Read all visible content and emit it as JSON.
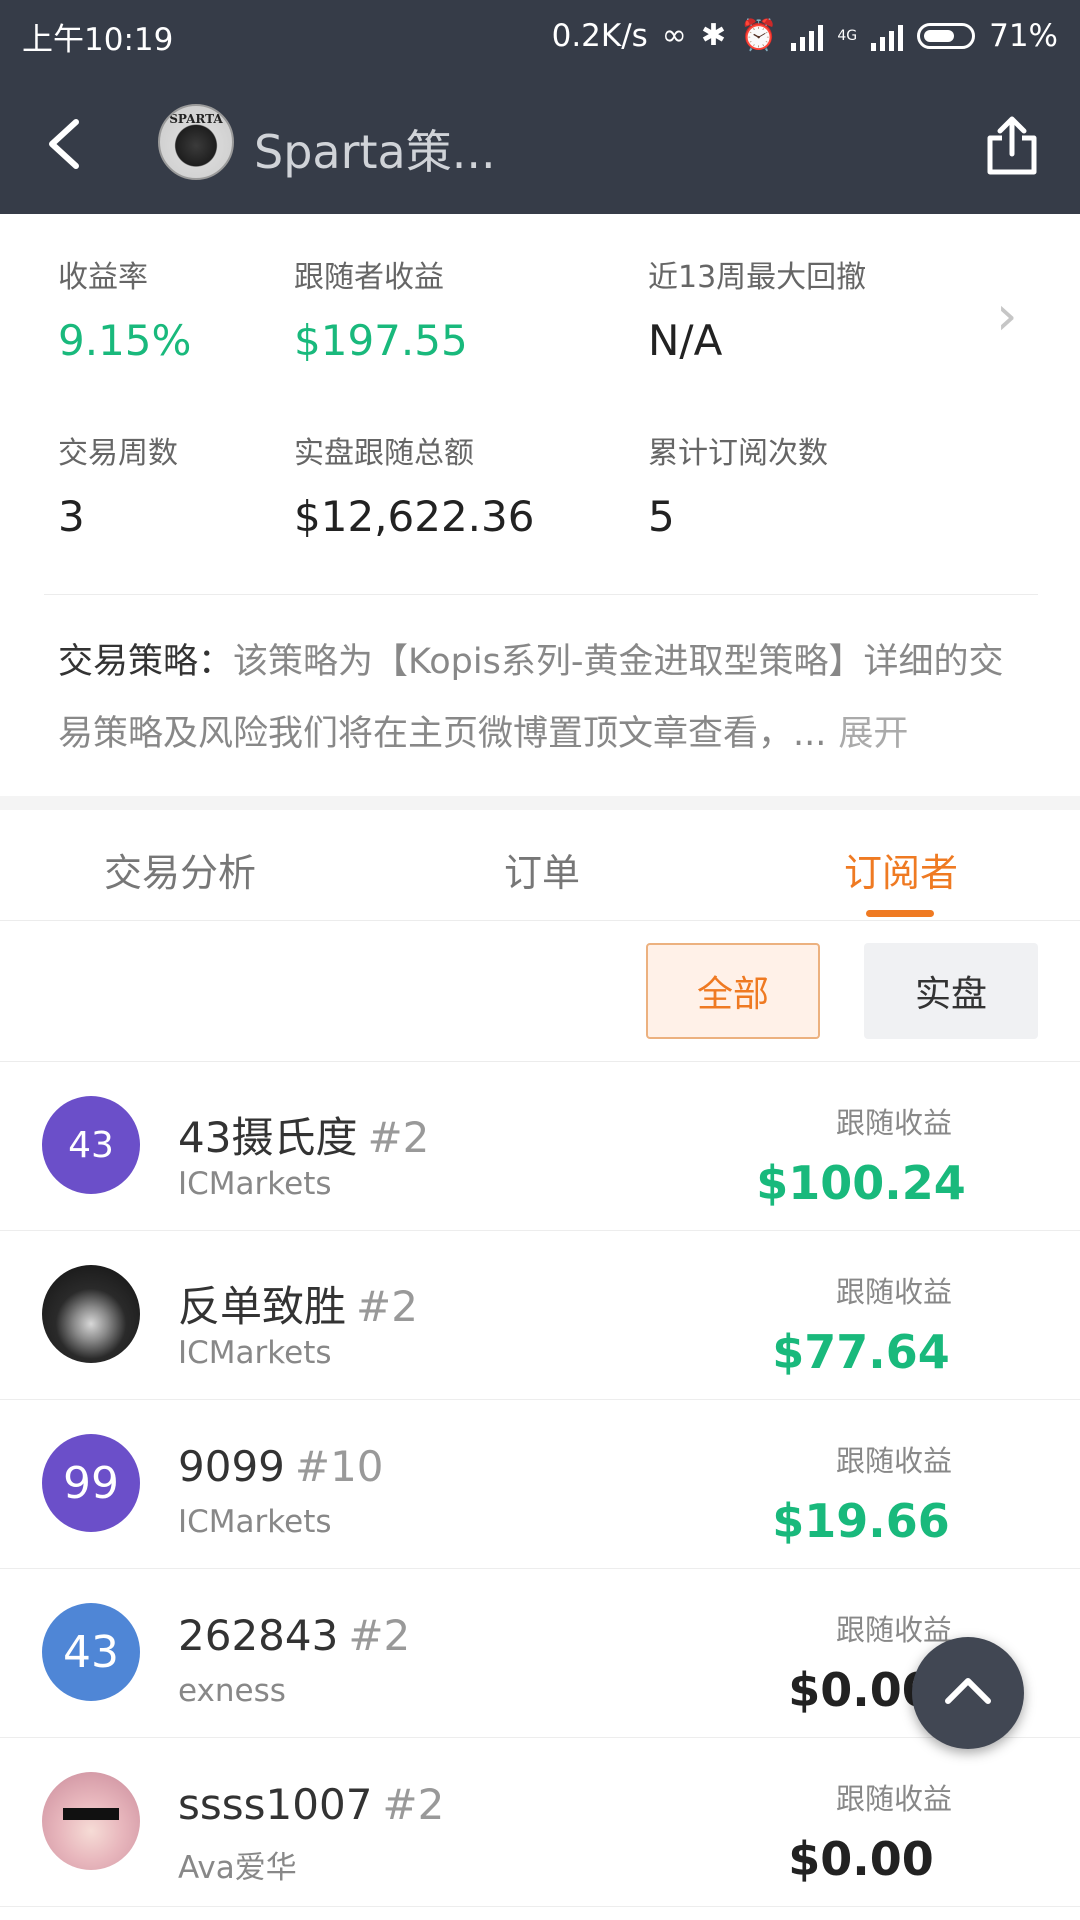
{
  "status_bar": {
    "time": "上午10:19",
    "speed": "0.2K/s",
    "network": "4G",
    "battery": "71%"
  },
  "nav": {
    "title": "Sparta策...",
    "logo_text": "SPARTA"
  },
  "stats": [
    {
      "label": "收益率",
      "value": "9.15%",
      "highlight": true
    },
    {
      "label": "跟随者收益",
      "value": "$197.55",
      "highlight": true
    },
    {
      "label": "近13周最大回撤",
      "value": "N/A",
      "highlight": false
    },
    {
      "label": "交易周数",
      "value": "3",
      "highlight": false
    },
    {
      "label": "实盘跟随总额",
      "value": "$12,622.36",
      "highlight": false
    },
    {
      "label": "累计订阅次数",
      "value": "5",
      "highlight": false
    }
  ],
  "strategy": {
    "label": "交易策略：",
    "text": "该策略为【Kopis系列-黄金进取型策略】详细的交易策略及风险我们将在主页微博置顶文章查看，...",
    "more": "展开"
  },
  "tabs": [
    {
      "label": "交易分析",
      "active": false
    },
    {
      "label": "订单",
      "active": false
    },
    {
      "label": "订阅者",
      "active": true
    }
  ],
  "filters": {
    "all_label": "全部",
    "real_label": "实盘"
  },
  "subscribers": [
    {
      "avatar_text": "43",
      "avatar_color": "#6b4fc9",
      "name": "43摄氏度",
      "rank": "#2",
      "broker": "ICMarkets",
      "earn_label": "跟随收益",
      "earnings": "$100.24",
      "positive": true
    },
    {
      "avatar_text": "",
      "avatar_color": "#1e1e1e",
      "name": "反单致胜",
      "rank": "#2",
      "broker": "ICMarkets",
      "earn_label": "跟随收益",
      "earnings": "$77.64",
      "positive": true
    },
    {
      "avatar_text": "99",
      "avatar_color": "#6b4fc9",
      "name": "9099",
      "rank": "#10",
      "broker": "ICMarkets",
      "earn_label": "跟随收益",
      "earnings": "$19.66",
      "positive": true
    },
    {
      "avatar_text": "43",
      "avatar_color": "#4f86d6",
      "name": "262843",
      "rank": "#2",
      "broker": "exness",
      "earn_label": "跟随收益",
      "earnings": "$0.00",
      "positive": false
    },
    {
      "avatar_text": "",
      "avatar_color": "#d9a8b4",
      "name": "ssss1007",
      "rank": "#2",
      "broker": "Ava爱华",
      "earn_label": "跟随收益",
      "earnings": "$0.00",
      "positive": false
    }
  ],
  "colors": {
    "accent": "#ef7a22",
    "positive": "#19b97c",
    "header_bg": "#363c48"
  },
  "icons": [
    "back-arrow-icon",
    "share-icon",
    "chevron-right-icon",
    "scroll-top-icon"
  ]
}
